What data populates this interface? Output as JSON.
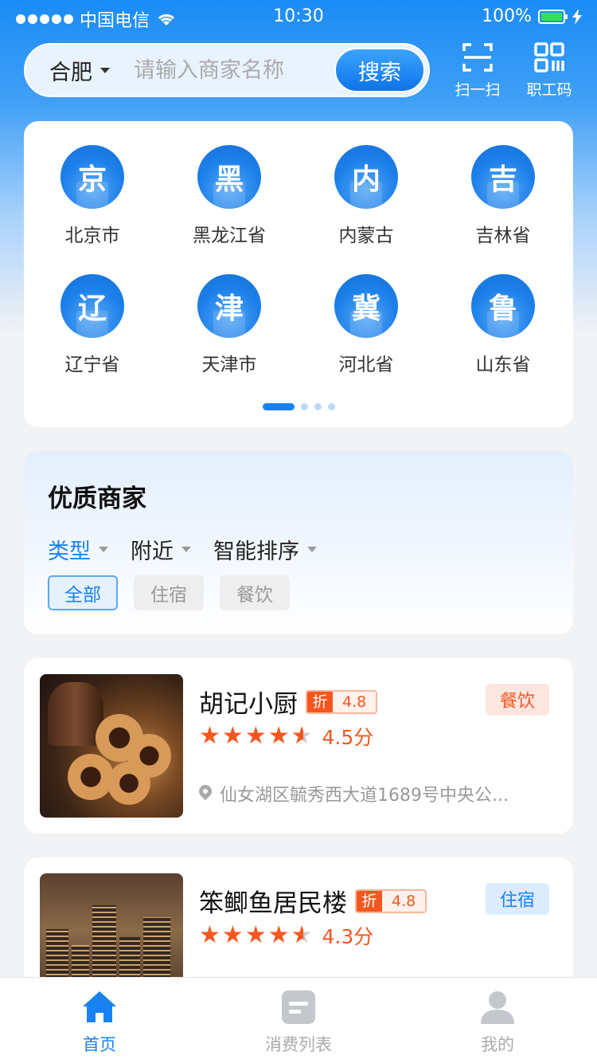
{
  "status_bar": {
    "carrier": "中国电信",
    "time": "10:30",
    "battery": "100%"
  },
  "header": {
    "city": "合肥",
    "search_placeholder": "请输入商家名称",
    "search_button": "搜索",
    "scan_label": "扫一扫",
    "staff_code_label": "职工码"
  },
  "provinces": [
    {
      "char": "京",
      "name": "北京市"
    },
    {
      "char": "黑",
      "name": "黑龙江省"
    },
    {
      "char": "内",
      "name": "内蒙古"
    },
    {
      "char": "吉",
      "name": "吉林省"
    },
    {
      "char": "辽",
      "name": "辽宁省"
    },
    {
      "char": "津",
      "name": "天津市"
    },
    {
      "char": "冀",
      "name": "河北省"
    },
    {
      "char": "鲁",
      "name": "山东省"
    }
  ],
  "province_pager": {
    "pages": 4,
    "current": 1
  },
  "quality_merchants": {
    "title": "优质商家",
    "filters": [
      {
        "label": "类型",
        "active": true
      },
      {
        "label": "附近",
        "active": false
      },
      {
        "label": "智能排序",
        "active": false
      }
    ],
    "chips": [
      {
        "label": "全部",
        "active": true
      },
      {
        "label": "住宿",
        "active": false
      },
      {
        "label": "餐饮",
        "active": false
      }
    ]
  },
  "merchants": [
    {
      "name": "胡记小厨",
      "discount_mark": "折",
      "discount": "4.8",
      "stars": 4.5,
      "score": "4.5分",
      "address": "仙女湖区毓秀西大道1689号中央公...",
      "tag": "餐饮"
    },
    {
      "name": "笨鲫鱼居民楼",
      "discount_mark": "折",
      "discount": "4.8",
      "stars": 4.3,
      "score": "4.3分",
      "address": "",
      "tag": "住宿"
    }
  ],
  "tab_bar": [
    {
      "label": "首页",
      "icon": "home-icon",
      "active": true
    },
    {
      "label": "消费列表",
      "icon": "list-icon",
      "active": false
    },
    {
      "label": "我的",
      "icon": "profile-icon",
      "active": false
    }
  ],
  "colors": {
    "primary": "#1a82f0",
    "accent": "#f5571f",
    "background": "#f2f3f5"
  }
}
